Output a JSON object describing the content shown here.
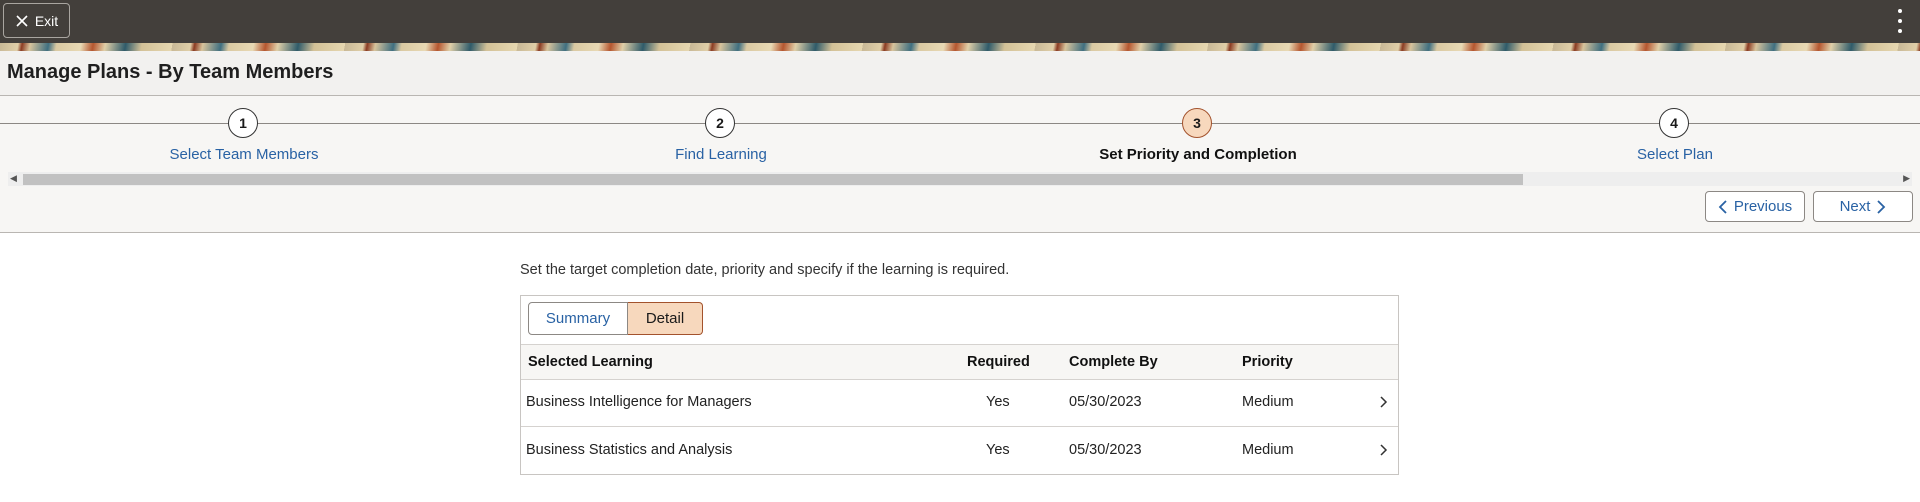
{
  "topbar": {
    "exit_label": "Exit"
  },
  "page": {
    "title": "Manage Plans - By Team Members"
  },
  "steps": [
    {
      "number": "1",
      "label": "Select Team Members"
    },
    {
      "number": "2",
      "label": "Find Learning"
    },
    {
      "number": "3",
      "label": "Set Priority and Completion",
      "active": true
    },
    {
      "number": "4",
      "label": "Select Plan"
    }
  ],
  "nav": {
    "previous_label": "Previous",
    "next_label": "Next"
  },
  "content": {
    "instructions": "Set the target completion date, priority and specify if the learning is required.",
    "toggle": {
      "summary_label": "Summary",
      "detail_label": "Detail",
      "selected": "Detail"
    },
    "columns": [
      "Selected Learning",
      "Required",
      "Complete By",
      "Priority"
    ],
    "rows": [
      {
        "learning": "Business Intelligence for Managers",
        "required": "Yes",
        "complete_by": "05/30/2023",
        "priority": "Medium"
      },
      {
        "learning": "Business Statistics and Analysis",
        "required": "Yes",
        "complete_by": "05/30/2023",
        "priority": "Medium"
      }
    ]
  },
  "colors": {
    "topbar": "#433f3b",
    "link": "#2962a4",
    "active_fill": "#f7d8bd",
    "active_border": "#a3522c"
  },
  "icons": [
    "close-icon",
    "more-vertical-icon",
    "chevron-left-icon",
    "chevron-right-icon"
  ]
}
